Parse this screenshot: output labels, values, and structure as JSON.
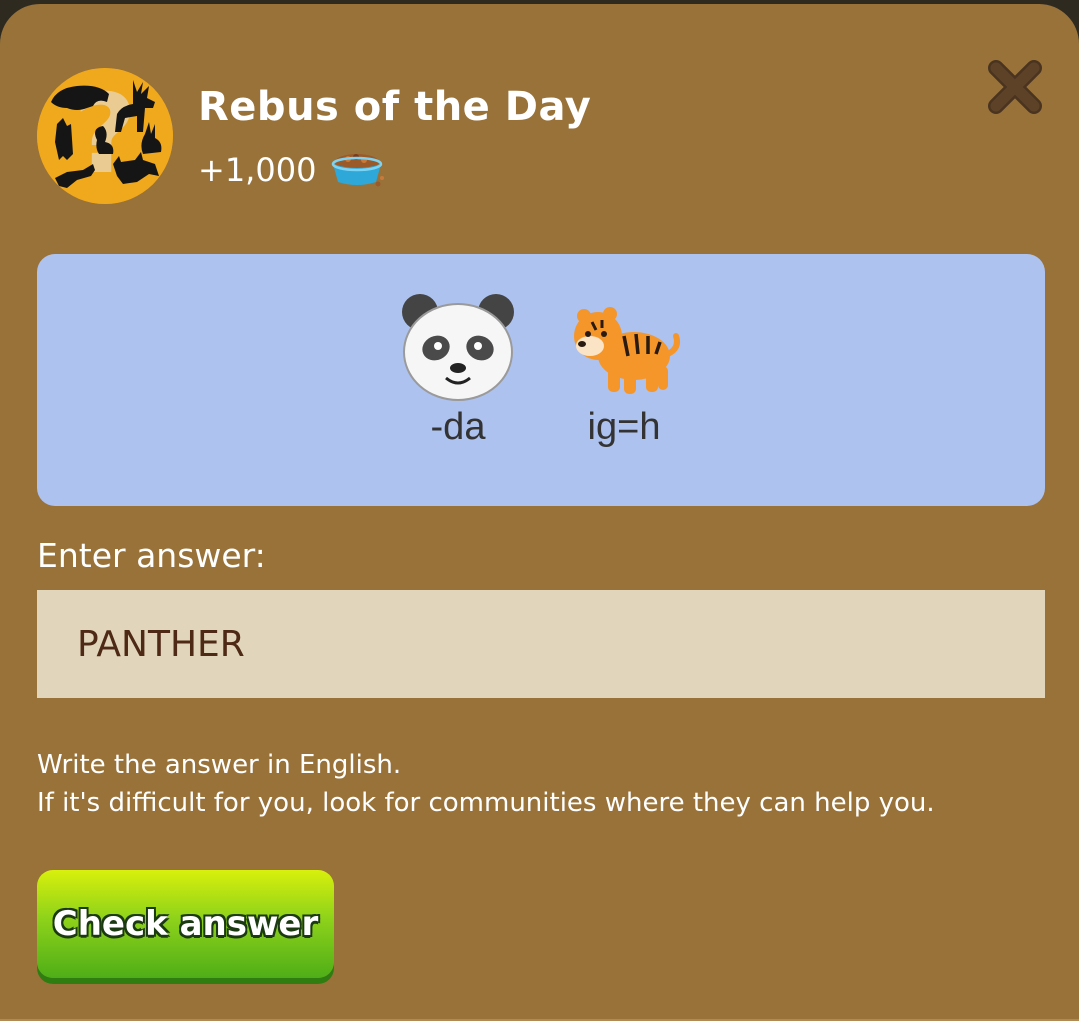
{
  "modal": {
    "title": "Rebus of the Day",
    "reward_amount": "+1,000",
    "reward_icon": "pet-food-bowl-icon",
    "close_icon": "close-icon",
    "avatar_icon": "animal-silhouettes-question-icon"
  },
  "puzzle": {
    "items": [
      {
        "icon": "panda-emoji",
        "hint": "-da"
      },
      {
        "icon": "tiger-emoji",
        "hint": "ig=h"
      }
    ]
  },
  "answer": {
    "label": "Enter answer:",
    "value": "PANTHER"
  },
  "instructions": {
    "line1": "Write the answer in English.",
    "line2": "If it's difficult for you, look for communities where they can help you."
  },
  "actions": {
    "check_label": "Check answer"
  },
  "colors": {
    "modal_bg": "#99723a",
    "puzzle_bg": "#adc2ee",
    "input_bg": "#e1d5bb",
    "button_green": "#6cc018",
    "avatar_bg": "#f0a81c"
  }
}
